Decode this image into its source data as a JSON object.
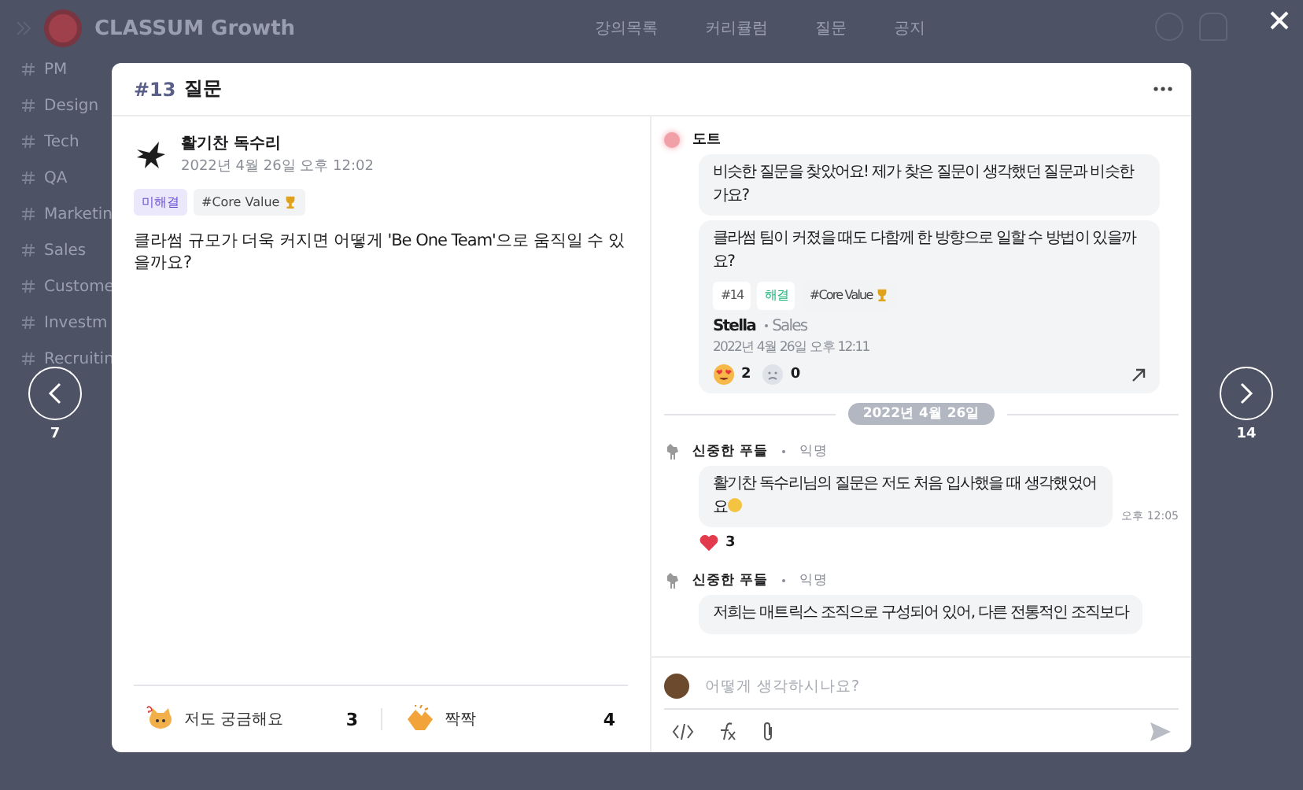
{
  "app": {
    "brand": "CLASSUM Growth",
    "nav": [
      "강의목록",
      "커리큘럼",
      "질문",
      "공지"
    ],
    "channels": [
      {
        "name": "PM"
      },
      {
        "name": "Design"
      },
      {
        "name": "Tech"
      },
      {
        "name": "QA"
      },
      {
        "name": "Marketin"
      },
      {
        "name": "Sales"
      },
      {
        "name": "Custome"
      },
      {
        "name": "Investm"
      },
      {
        "name": "Recruitin"
      }
    ]
  },
  "prev": {
    "label": "7"
  },
  "next": {
    "label": "14"
  },
  "modal": {
    "number": "#13",
    "title": "질문",
    "question": {
      "author": "활기찬 독수리",
      "time": "2022년 4월 26일 오후 12:02",
      "tags": [
        {
          "label": "미해결",
          "kind": "unresolved"
        },
        {
          "label": "#Core Value",
          "kind": "topic"
        }
      ],
      "body": "클라썸 규모가 더욱 커지면 어떻게 'Be One Team'으로 움직일 수 있을까요?",
      "reactions": [
        {
          "label": "저도 궁금해요",
          "count": "3",
          "kind": "curious"
        },
        {
          "label": "짝짝",
          "count": "4",
          "kind": "clap"
        }
      ]
    },
    "bot": {
      "author": "도트",
      "message": "비슷한 질문을 찾았어요! 제가 찾은 질문이 생각했던 질문과 비슷한가요?",
      "similar": {
        "title": "클라썸 팀이 커졌을 때도 다함께 한 방향으로 일할 수 방법이 있을까요?",
        "tags": [
          {
            "label": "#14",
            "kind": "number"
          },
          {
            "label": "해결",
            "kind": "resolved"
          },
          {
            "label": "#Core Value",
            "kind": "topic"
          }
        ],
        "author": "Stella",
        "team": "Sales",
        "time": "2022년 4월 26일 오후 12:11",
        "reactions": [
          {
            "kind": "star-eyes",
            "count": "2"
          },
          {
            "kind": "sad",
            "count": "0"
          }
        ]
      }
    },
    "date_divider": "2022년 4월 26일",
    "comments": [
      {
        "author": "신중한 푸들",
        "badge": "익명",
        "body": "활기찬 독수리님의 질문은 저도 처음 입사했을 때 생각했었어요",
        "time": "오후 12:05",
        "reactions": [
          {
            "kind": "heart",
            "count": "3"
          }
        ]
      },
      {
        "author": "신중한 푸들",
        "badge": "익명",
        "body": "저희는 매트릭스 조직으로 구성되어 있어, 다른 전통적인 조직보다"
      }
    ],
    "composer": {
      "placeholder": "어떻게 생각하시나요?"
    }
  }
}
